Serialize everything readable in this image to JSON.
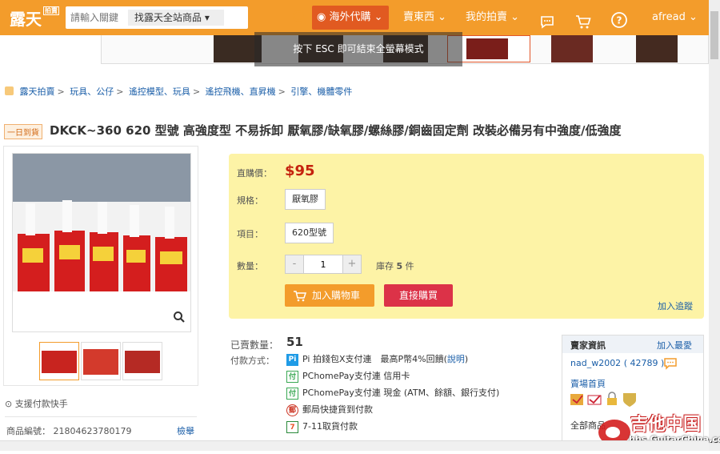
{
  "header": {
    "logo": "露天",
    "logo_badge": "拍賣",
    "search_placeholder": "請輸入關鍵",
    "search_scope": "找露天全站商品",
    "nav": {
      "overseas": "海外代購",
      "sell": "賣東西",
      "mine": "我的拍賣",
      "user": "afread"
    }
  },
  "banner": {
    "tip": "按下 ESC 即可結束全螢幕模式"
  },
  "breadcrumb": [
    "露天拍賣",
    "玩具、公仔",
    "遙控模型、玩具",
    "遙控飛機、直昇機",
    "引擎、機體零件"
  ],
  "product": {
    "badge": "一日到貨",
    "title": "DKCK~360 620 型號 高強度型 不易拆卸 厭氧膠/缺氧膠/螺絲膠/銅齒固定劑 改裝必備另有中強度/低強度",
    "price_label": "直購價：",
    "price": "$95",
    "spec_label": "規格：",
    "spec_value": "厭氧膠",
    "item_label": "項目：",
    "item_value": "620型號",
    "qty_label": "數量：",
    "qty": "1",
    "stock_prefix": "庫存",
    "stock_count": "5",
    "stock_unit": "件",
    "add_to_cart": "加入購物車",
    "buy_now": "直接購買",
    "track": "加入追蹤",
    "sold_label": "已賣數量：",
    "sold_count": "51",
    "payment_label": "付款方式：",
    "payments": [
      {
        "icon": "Pi",
        "text": "Pi 拍錢包X支付連　最高P幣4%回饋",
        "link": "說明",
        "color": "#1f9be6"
      },
      {
        "icon": "付",
        "text": "PChomePay支付連 信用卡",
        "link": "",
        "color": "#3aa853"
      },
      {
        "icon": "付",
        "text": "PChomePay支付連 現金 (ATM、餘額、銀行支付)",
        "link": "",
        "color": "#3aa853"
      },
      {
        "icon": "郵",
        "text": "郵局快捷貨到付款",
        "link": "",
        "color": "#cc3322"
      },
      {
        "icon": "7",
        "text": "7-11取貨付款",
        "link": "",
        "color": "#e8542a"
      }
    ],
    "fast_pay": "支援付款快手",
    "product_id_label": "商品編號：",
    "product_id": "21804623780179",
    "report": "檢舉"
  },
  "seller": {
    "title": "賣家資訊",
    "favorite": "加入最愛",
    "name": "nad_w2002",
    "rating": "( 42789 )",
    "store": "賣場首頁",
    "all_items": "全部商品"
  },
  "watermark": {
    "title": "吉他中国",
    "url": "bbs.GuitarChina.com"
  },
  "colors": {
    "brand": "#f39c2b",
    "price": "#c5220e",
    "buy": "#dc3248",
    "link": "#1a5ea8"
  }
}
